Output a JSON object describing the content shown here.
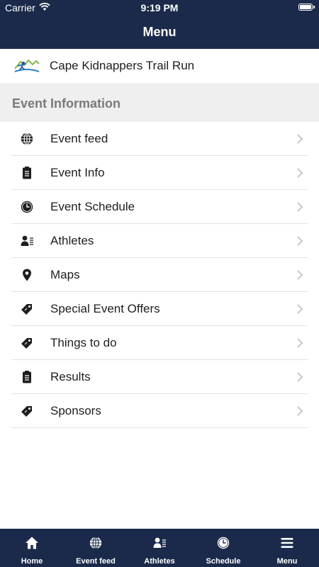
{
  "status_bar": {
    "carrier": "Carrier",
    "time": "9:19 PM"
  },
  "nav": {
    "title": "Menu"
  },
  "event": {
    "name": "Cape Kidnappers Trail Run"
  },
  "section": {
    "title": "Event Information"
  },
  "menu": {
    "items": [
      {
        "label": "Event feed",
        "icon": "globe-icon"
      },
      {
        "label": "Event Info",
        "icon": "clipboard-icon"
      },
      {
        "label": "Event Schedule",
        "icon": "clock-icon"
      },
      {
        "label": "Athletes",
        "icon": "athletes-icon"
      },
      {
        "label": "Maps",
        "icon": "map-pin-icon"
      },
      {
        "label": "Special Event Offers",
        "icon": "tag-icon"
      },
      {
        "label": "Things to do",
        "icon": "tag-icon"
      },
      {
        "label": "Results",
        "icon": "clipboard-icon"
      },
      {
        "label": "Sponsors",
        "icon": "tag-icon"
      }
    ]
  },
  "tabbar": {
    "items": [
      {
        "label": "Home",
        "icon": "home-icon"
      },
      {
        "label": "Event feed",
        "icon": "globe-icon"
      },
      {
        "label": "Athletes",
        "icon": "athletes-icon"
      },
      {
        "label": "Schedule",
        "icon": "clock-icon"
      },
      {
        "label": "Menu",
        "icon": "hamburger-icon"
      }
    ]
  },
  "colors": {
    "nav_bg": "#1b2a4a",
    "section_bg": "#efefef",
    "section_text": "#7a7a7a",
    "icon_color": "#1e1e1e",
    "chevron": "#c7c7cc"
  }
}
